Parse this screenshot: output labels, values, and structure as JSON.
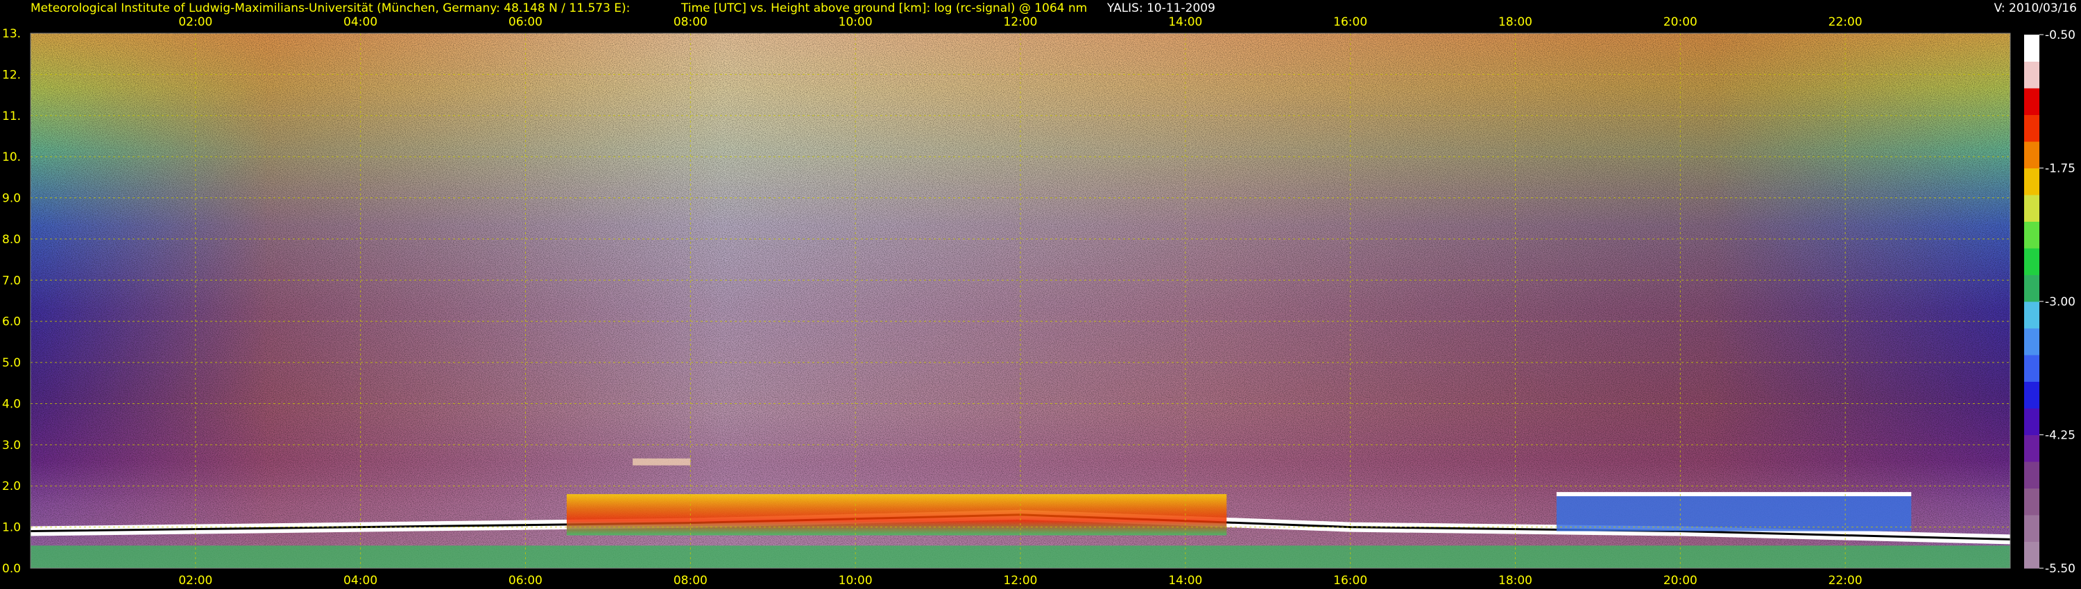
{
  "header": {
    "institute": "Meteorological Institute of Ludwig-Maximilians-Universität (München, Germany: 48.148 N / 11.573 E):",
    "description": "Time [UTC] vs. Height above ground [km]: log (rc-signal) @ 1064 nm",
    "instrument_date": "YALIS: 10-11-2009",
    "version": "V: 2010/03/16"
  },
  "colors": {
    "background": "#000000",
    "text": "#ffff00",
    "grid": "#c8c800",
    "colorbar_text": "#ffffff"
  },
  "chart_data": {
    "type": "heatmap",
    "title": "Time [UTC] vs. Height above ground [km]: log (rc-signal) @ 1064 nm",
    "xlabel": "",
    "ylabel": "",
    "x_ticks": [
      "02:00",
      "04:00",
      "06:00",
      "08:00",
      "10:00",
      "12:00",
      "14:00",
      "16:00",
      "18:00",
      "20:00",
      "22:00"
    ],
    "x_tick_hours": [
      2,
      4,
      6,
      8,
      10,
      12,
      14,
      16,
      18,
      20,
      22
    ],
    "xlim_hours": [
      0,
      24
    ],
    "y_ticks": [
      "0.0",
      "1.0",
      "2.0",
      "3.0",
      "4.0",
      "5.0",
      "6.0",
      "7.0",
      "8.0",
      "9.0",
      "10.",
      "11.",
      "12.",
      "13."
    ],
    "y_tick_values": [
      0,
      1,
      2,
      3,
      4,
      5,
      6,
      7,
      8,
      9,
      10,
      11,
      12,
      13
    ],
    "ylim_km": [
      0,
      13
    ],
    "grid": true,
    "colorbar": {
      "ticks": [
        "-0.50",
        "-1.75",
        "-3.00",
        "-4.25",
        "-5.50"
      ],
      "tick_values": [
        -0.5,
        -1.75,
        -3.0,
        -4.25,
        -5.5
      ],
      "range": [
        -5.5,
        -0.5
      ],
      "colors": [
        "#a888a8",
        "#9c749c",
        "#8c5a8c",
        "#7a3c8a",
        "#6a1ea0",
        "#4a10b8",
        "#2020e0",
        "#3a60f0",
        "#4a90f0",
        "#50c0e8",
        "#30b060",
        "#20d040",
        "#60e040",
        "#d0e040",
        "#f0c000",
        "#f08000",
        "#f03000",
        "#e00000",
        "#f0c8c8",
        "#ffffff"
      ]
    },
    "features": [
      {
        "name": "boundary layer top",
        "start_hour": 0.0,
        "end_hour": 24.0,
        "height_km": [
          0.9,
          1.0,
          1.1,
          1.3,
          1.0,
          0.9,
          0.7
        ]
      },
      {
        "name": "daytime aerosol layer",
        "start_hour": 6.5,
        "end_hour": 14.5,
        "top_km": 1.8
      },
      {
        "name": "elevated aerosol",
        "start_hour": 7.3,
        "end_hour": 8.0,
        "height_km": 2.6
      },
      {
        "name": "low cloud",
        "start_hour": 18.5,
        "end_hour": 22.8,
        "height_km": [
          0.9,
          1.8
        ]
      }
    ]
  }
}
